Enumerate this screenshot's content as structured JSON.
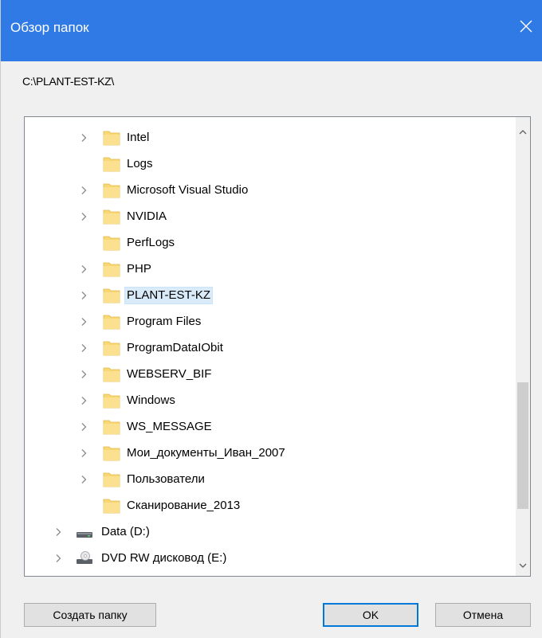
{
  "window": {
    "title": "Обзор папок"
  },
  "path": "C:\\PLANT-EST-KZ\\",
  "tree": {
    "items": [
      {
        "label": "Intel",
        "expandable": true,
        "type": "folder",
        "selected": false
      },
      {
        "label": "Logs",
        "expandable": false,
        "type": "folder",
        "selected": false
      },
      {
        "label": "Microsoft Visual Studio",
        "expandable": true,
        "type": "folder",
        "selected": false
      },
      {
        "label": "NVIDIA",
        "expandable": true,
        "type": "folder",
        "selected": false
      },
      {
        "label": "PerfLogs",
        "expandable": false,
        "type": "folder",
        "selected": false
      },
      {
        "label": "PHP",
        "expandable": true,
        "type": "folder",
        "selected": false
      },
      {
        "label": "PLANT-EST-KZ",
        "expandable": true,
        "type": "folder",
        "selected": true
      },
      {
        "label": "Program Files",
        "expandable": true,
        "type": "folder",
        "selected": false
      },
      {
        "label": "ProgramDataIObit",
        "expandable": true,
        "type": "folder",
        "selected": false
      },
      {
        "label": "WEBSERV_BIF",
        "expandable": true,
        "type": "folder",
        "selected": false
      },
      {
        "label": "Windows",
        "expandable": true,
        "type": "folder",
        "selected": false
      },
      {
        "label": "WS_MESSAGE",
        "expandable": true,
        "type": "folder",
        "selected": false
      },
      {
        "label": "Мои_документы_Иван_2007",
        "expandable": true,
        "type": "folder",
        "selected": false
      },
      {
        "label": "Пользователи",
        "expandable": true,
        "type": "folder",
        "selected": false
      },
      {
        "label": "Сканирование_2013",
        "expandable": false,
        "type": "folder",
        "selected": false
      },
      {
        "label": "Data (D:)",
        "expandable": true,
        "type": "drive",
        "selected": false
      },
      {
        "label": "DVD RW дисковод (E:)",
        "expandable": true,
        "type": "dvd",
        "selected": false
      }
    ]
  },
  "buttons": {
    "new_folder": "Создать папку",
    "ok": "OK",
    "cancel": "Отмена"
  },
  "colors": {
    "titlebar": "#2f7ae5",
    "folder": "#f8d775",
    "selection": "#d9ebf9",
    "ok_border": "#0078d7"
  },
  "icons": {
    "close": "close-icon",
    "expand": "chevron-right-icon",
    "folder": "folder-icon",
    "drive": "drive-icon",
    "dvd": "dvd-drive-icon",
    "scroll_up": "chevron-up-icon",
    "scroll_down": "chevron-down-icon"
  }
}
